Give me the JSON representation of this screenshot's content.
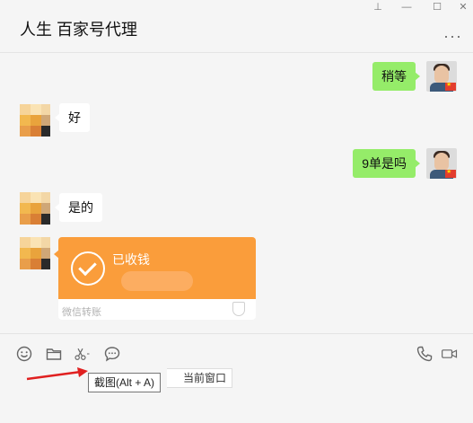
{
  "window": {
    "title": "人生 百家号代理",
    "controls": {
      "pin": "⊥",
      "minimize": "—",
      "maximize": "☐",
      "close": "✕"
    },
    "more": "···"
  },
  "messages": [
    {
      "side": "out",
      "text": "稍等"
    },
    {
      "side": "in",
      "text": "好"
    },
    {
      "side": "out",
      "text": "9单是吗"
    },
    {
      "side": "in",
      "text": "是的"
    }
  ],
  "transfer": {
    "status": "已收钱",
    "footer": "微信转账"
  },
  "toolbar": {
    "icons": [
      "emoji-icon",
      "folder-icon",
      "scissors-icon",
      "chat-history-icon",
      "phone-icon",
      "video-call-icon"
    ]
  },
  "tooltip": {
    "text": "截图(Alt + A)",
    "partial": "当前窗口"
  },
  "colors": {
    "outgoing_bubble": "#95ec69",
    "incoming_bubble": "#ffffff",
    "transfer_orange": "#fa9d3b",
    "arrow_red": "#e02020"
  }
}
